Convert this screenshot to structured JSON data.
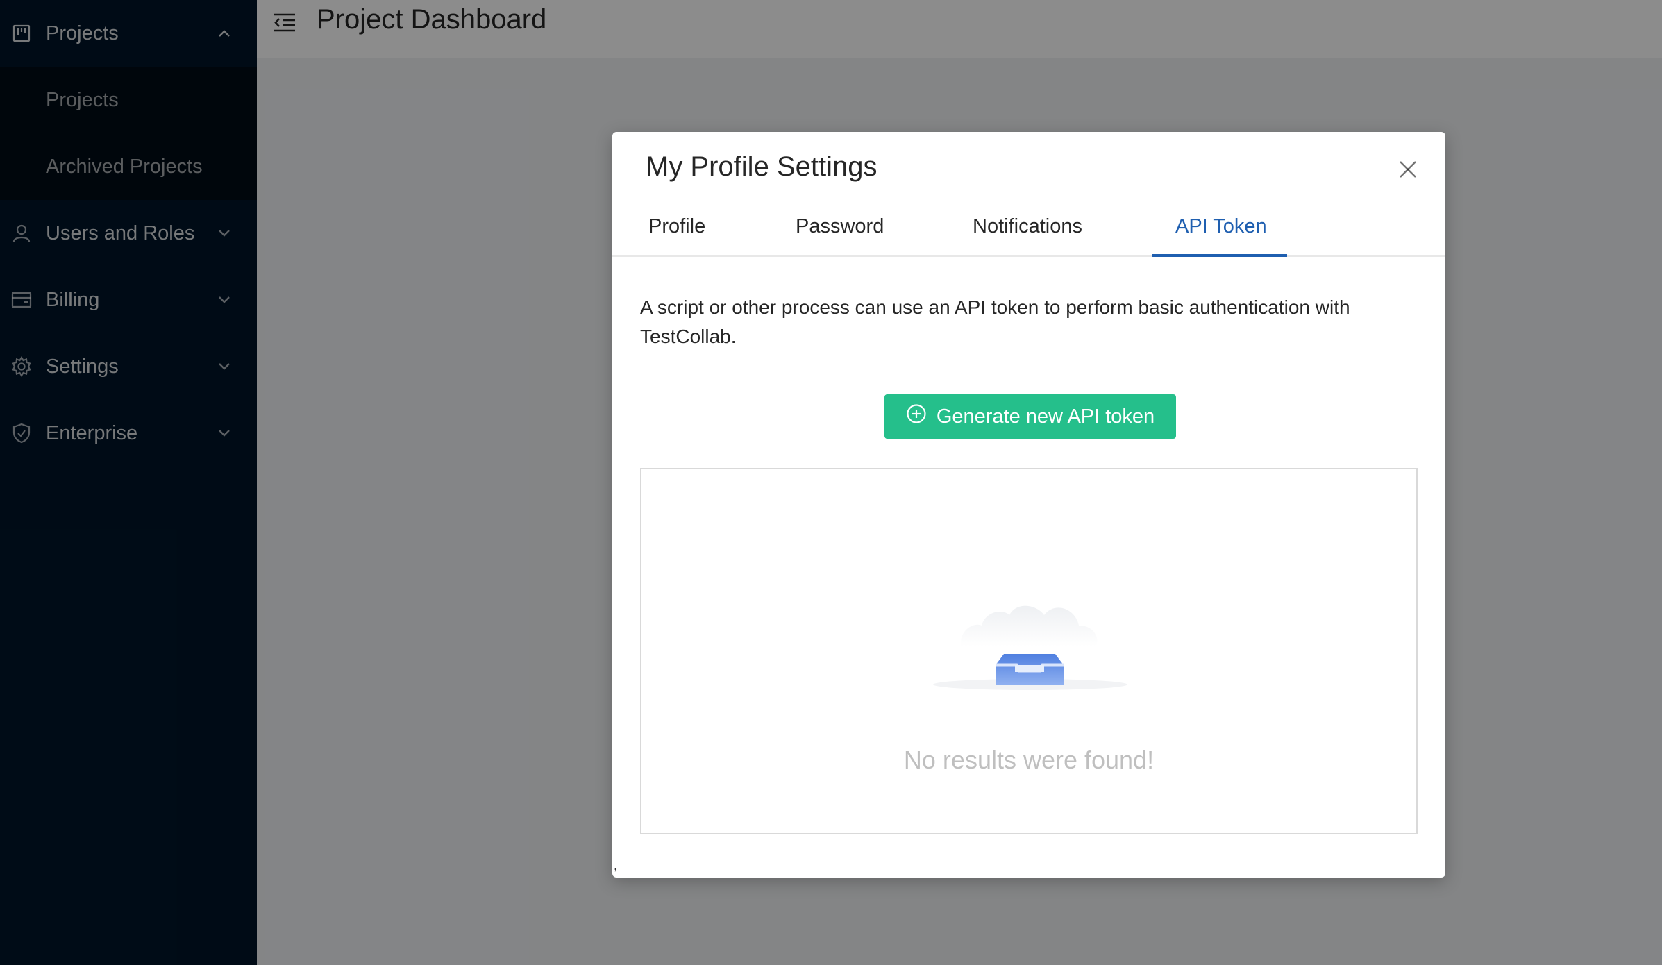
{
  "sidebar": {
    "projects_label": "Projects",
    "sub_items": [
      "Projects",
      "Archived Projects"
    ],
    "items": [
      {
        "label": "Users and Roles",
        "icon": "user-icon"
      },
      {
        "label": "Billing",
        "icon": "credit-card-icon"
      },
      {
        "label": "Settings",
        "icon": "gear-icon"
      },
      {
        "label": "Enterprise",
        "icon": "shield-icon"
      }
    ]
  },
  "header": {
    "title": "Project Dashboard",
    "menu_icon": "menu-fold-icon"
  },
  "modal": {
    "title": "My Profile Settings",
    "close_icon": "close-icon",
    "tabs": [
      "Profile",
      "Password",
      "Notifications",
      "API Token"
    ],
    "active_tab": "API Token",
    "description": "A script or other process can use an API token to perform basic authentication with TestCollab.",
    "generate_button": "Generate new API token",
    "generate_icon": "plus-circle-icon",
    "empty_text": "No results were found!",
    "empty_icon": "empty-inbox-icon",
    "stray_mark": ","
  },
  "colors": {
    "sidebar_bg": "#001529",
    "accent": "#1f5fb0",
    "button_green": "#25bf8b"
  }
}
